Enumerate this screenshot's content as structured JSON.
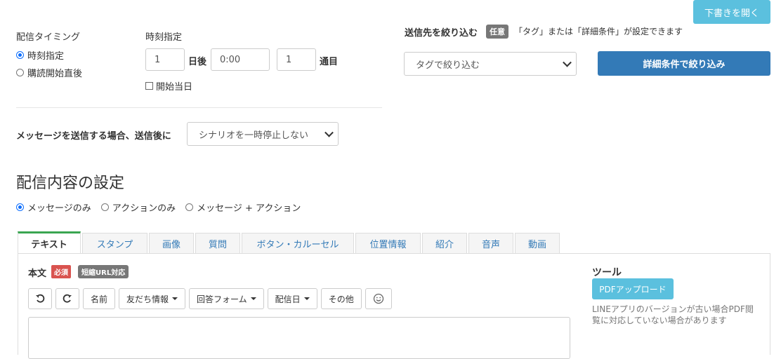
{
  "draft_button": "下書きを開く",
  "timing": {
    "label": "配信タイミング",
    "options": [
      "時刻指定",
      "購読開始直後"
    ]
  },
  "time_spec": {
    "label": "時刻指定",
    "days_value": "1",
    "days_suffix": "日後",
    "time_value": "0:00",
    "count_value": "1",
    "count_suffix": "通目",
    "start_day_label": "開始当日"
  },
  "filter": {
    "label": "送信先を絞り込む",
    "badge": "任意",
    "hint": "「タグ」または「詳細条件」が設定できます",
    "tag_select": "タグで絞り込む",
    "detail_button": "詳細条件で絞り込み"
  },
  "after_send": {
    "label": "メッセージを送信する場合、送信後に",
    "select": "シナリオを一時停止しない"
  },
  "content": {
    "title": "配信内容の設定",
    "options": [
      "メッセージのみ",
      "アクションのみ",
      "メッセージ + アクション"
    ]
  },
  "tabs": [
    "テキスト",
    "スタンプ",
    "画像",
    "質問",
    "ボタン・カルーセル",
    "位置情報",
    "紹介",
    "音声",
    "動画"
  ],
  "editor": {
    "body_label": "本文",
    "required_badge": "必須",
    "url_badge": "短縮URL対応",
    "toolbar": {
      "name": "名前",
      "friend_info": "友だち情報",
      "answer_form": "回答フォーム",
      "delivery_date": "配信日",
      "other": "その他"
    }
  },
  "tools": {
    "title": "ツール",
    "pdf_button": "PDFアップロード",
    "note": "LINEアプリのバージョンが古い場合PDF閲覧に対応していない場合があります"
  },
  "colors": {
    "info": "#5bc0de",
    "primary": "#337ab7",
    "danger": "#d9534f",
    "active_tab_accent": "#3aa651",
    "radio_checked": "#0d6efd"
  }
}
